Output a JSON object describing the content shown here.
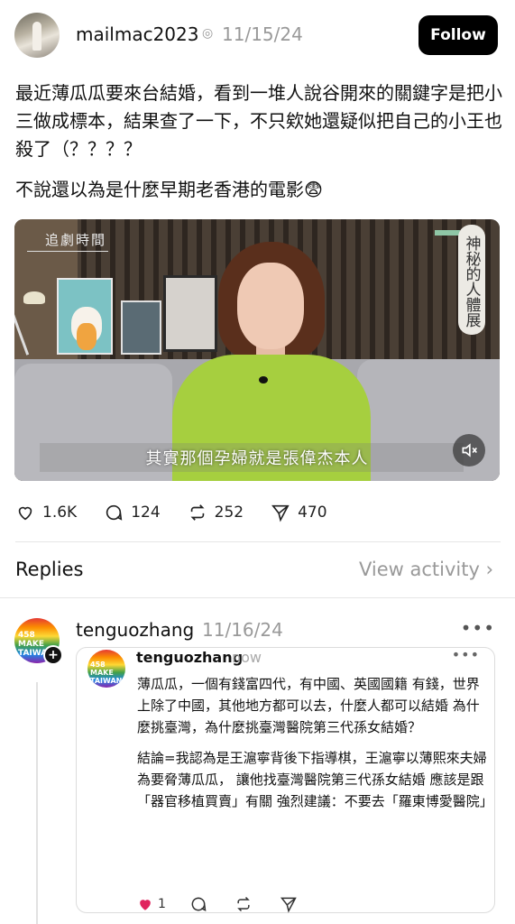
{
  "post": {
    "username": "mailmac2023",
    "verified_icon": "threads-linked-icon",
    "date": "11/15/24",
    "follow_label": "Follow",
    "text_line1": "最近薄瓜瓜要來台結婚，看到一堆人說谷開來的關鍵字是把小三做成標本，結果查了一下，不只欸她還疑似把自己的小王也殺了（？？？？",
    "text_line2": "不說還以為是什麼早期老香港的電影😨"
  },
  "video": {
    "logo_text": "追劇時間",
    "side_label": "神秘的人體展",
    "subtitle": "其實那個孕婦就是張偉杰本人",
    "mute_icon": "speaker-muted-icon"
  },
  "actions": {
    "likes": "1.6K",
    "comments": "124",
    "reposts": "252",
    "shares": "470"
  },
  "replies_section": {
    "label": "Replies",
    "view_activity": "View activity"
  },
  "reply": {
    "username": "tenguozhang",
    "date": "11/16/24",
    "avatar_text": "458 MAKE TAIWAN",
    "quote": {
      "username": "tenguozhang",
      "time": "now",
      "avatar_text": "458 MAKE TAIWAN",
      "para1": "薄瓜瓜，一個有錢富四代，有中國、英國國籍 有錢，世界上除了中國，其他地方都可以去，什麼人都可以結婚 為什麼挑臺灣，為什麼挑臺灣醫院第三代孫女結婚？",
      "para2": "結論=我認為是王滬寧背後下指導棋，王滬寧以薄熙來夫婦為要脅薄瓜瓜， 讓他找臺灣醫院第三代孫女結婚 應該是跟「器官移植買賣」有關 強烈建議：不要去「羅東博愛醫院」",
      "likes": "1"
    }
  },
  "colors": {
    "follow_bg": "#000000",
    "muted_text": "#999999",
    "like_red": "#e0245e"
  }
}
